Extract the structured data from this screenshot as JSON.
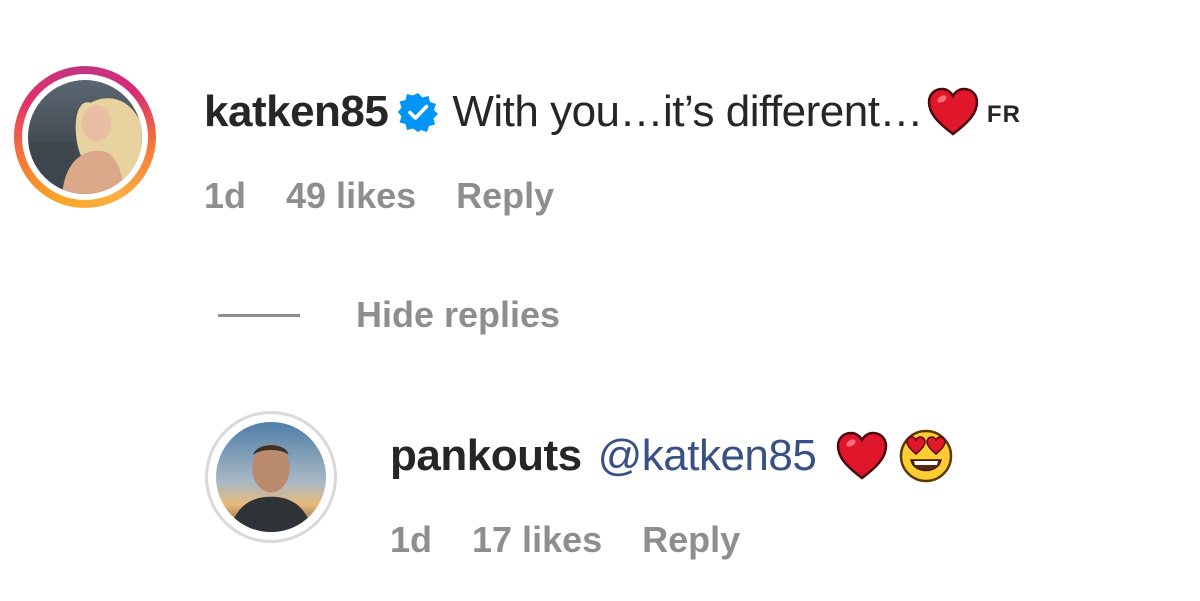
{
  "comment": {
    "username": "katken85",
    "verified": true,
    "text": "With you…it’s different…",
    "emoji": "red-heart",
    "translate_label": "FR",
    "meta": {
      "age": "1d",
      "likes": "49 likes",
      "reply_label": "Reply"
    }
  },
  "replies_toggle": {
    "label": "Hide replies"
  },
  "reply": {
    "username": "pankouts",
    "mention": "@katken85",
    "emojis": [
      "red-heart",
      "heart-eyes-face"
    ],
    "meta": {
      "age": "1d",
      "likes": "17 likes",
      "reply_label": "Reply"
    }
  },
  "colors": {
    "text": "#262626",
    "secondary": "#8e8e8e",
    "mention": "#385185",
    "verified_badge": "#0095f6",
    "heart": "#e0162b"
  }
}
